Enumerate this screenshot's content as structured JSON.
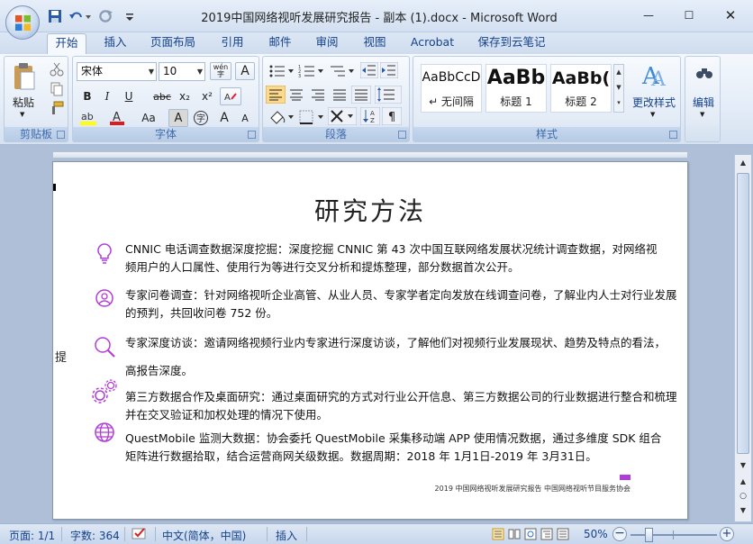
{
  "window": {
    "title": "2019中国网络视听发展研究报告 - 副本 (1).docx - Microsoft Word",
    "minimize_glyph": "—",
    "maximize_glyph": "☐",
    "close_glyph": "✕"
  },
  "tabs": [
    {
      "label": "开始",
      "active": true
    },
    {
      "label": "插入"
    },
    {
      "label": "页面布局"
    },
    {
      "label": "引用"
    },
    {
      "label": "邮件"
    },
    {
      "label": "审阅"
    },
    {
      "label": "视图"
    },
    {
      "label": "Acrobat"
    },
    {
      "label": "保存到云笔记"
    }
  ],
  "ribbon": {
    "clipboard": {
      "label": "剪贴板",
      "paste_label": "粘贴"
    },
    "font": {
      "label": "字体",
      "font_name": "宋体",
      "font_size": "10",
      "bold": "B",
      "italic": "I",
      "underline": "U",
      "strike": "abc",
      "subscript": "x₂",
      "superscript": "x²",
      "change_case": "Aa",
      "char_shade": "A",
      "grow": "A",
      "shrink": "A",
      "wen": "wén",
      "box_a": "A",
      "circle_char": "字"
    },
    "paragraph": {
      "label": "段落"
    },
    "styles": {
      "label": "样式",
      "tiles": [
        {
          "sample": "AaBbCcD",
          "name": "↵ 无间隔"
        },
        {
          "sample": "AaBb",
          "name": "标题 1"
        },
        {
          "sample": "AaBb(",
          "name": "标题 2"
        }
      ],
      "change_styles": "更改样式"
    },
    "editing": {
      "label": "编辑"
    }
  },
  "document": {
    "title": "研究方法",
    "side_char": "提",
    "items": [
      {
        "icon": "lightbulb-icon",
        "text": "CNNIC 电话调查数据深度挖掘：深度挖掘 CNNIC 第 43 次中国互联网络发展状况统计调查数据，对网络视频用户的人口属性、使用行为等进行交叉分析和提炼整理，部分数据首次公开。"
      },
      {
        "icon": "person-icon",
        "text": "专家问卷调查：针对网络视听企业高管、从业人员、专家学者定向发放在线调查问卷，了解业内人士对行业发展的预判，共回收问卷 752 份。"
      },
      {
        "icon": "search-icon",
        "text": "专家深度访谈：邀请网络视频行业内专家进行深度访谈，了解他们对视频行业发展现状、趋势及特点的看法，"
      },
      {
        "icon": "",
        "text": "高报告深度。"
      },
      {
        "icon": "gears-icon",
        "text": "第三方数据合作及桌面研究：通过桌面研究的方式对行业公开信息、第三方数据公司的行业数据进行整合和梳理并在交叉验证和加权处理的情况下使用。"
      },
      {
        "icon": "globe-icon",
        "text": "QuestMobile 监测大数据：协会委托 QuestMobile 采集移动端 APP 使用情况数据，通过多维度 SDK 组合矩阵进行数据拾取，结合运营商网关级数据。数据周期：2018 年 1月1日-2019 年 3月31日。"
      }
    ],
    "footer_note": "2019 中国网络视听发展研究报告 中国网络视听节目服务协会"
  },
  "status": {
    "page": "页面: 1/1",
    "words": "字数: 364",
    "language": "中文(简体，中国)",
    "mode": "插入",
    "zoom": "50%",
    "zoom_level": 0.5
  },
  "colors": {
    "accent_purple": "#b23cd8",
    "ribbon_text": "#15428b"
  }
}
